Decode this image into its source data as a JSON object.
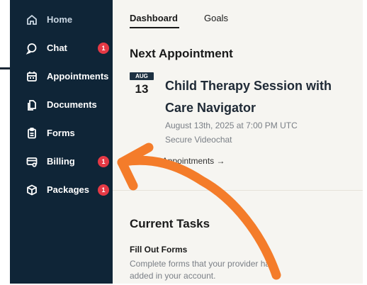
{
  "nav": {
    "items": [
      {
        "label": "Home",
        "icon": "home-icon",
        "badge": ""
      },
      {
        "label": "Chat",
        "icon": "chat-icon",
        "badge": "1"
      },
      {
        "label": "Appointments",
        "icon": "calendar-icon",
        "badge": ""
      },
      {
        "label": "Documents",
        "icon": "documents-icon",
        "badge": ""
      },
      {
        "label": "Forms",
        "icon": "clipboard-icon",
        "badge": ""
      },
      {
        "label": "Billing",
        "icon": "billing-icon",
        "badge": "1"
      },
      {
        "label": "Packages",
        "icon": "package-icon",
        "badge": "1"
      }
    ]
  },
  "tabs": {
    "dashboard": "Dashboard",
    "goals": "Goals"
  },
  "appointment": {
    "section_title": "Next Appointment",
    "month": "AUG",
    "day": "13",
    "title": "Child Therapy Session with Care Navigator",
    "datetime": "August 13th, 2025 at 7:00 PM UTC",
    "location": "Secure Videochat",
    "view_all": "View all Appointments →"
  },
  "tasks": {
    "section_title": "Current Tasks",
    "item_title": "Fill Out Forms",
    "item_desc": "Complete forms that your provider has added in your account."
  },
  "colors": {
    "sidebar": "#0f2537",
    "badge": "#e53945",
    "arrow": "#f47c2a",
    "main_bg": "#f6f5f1"
  }
}
